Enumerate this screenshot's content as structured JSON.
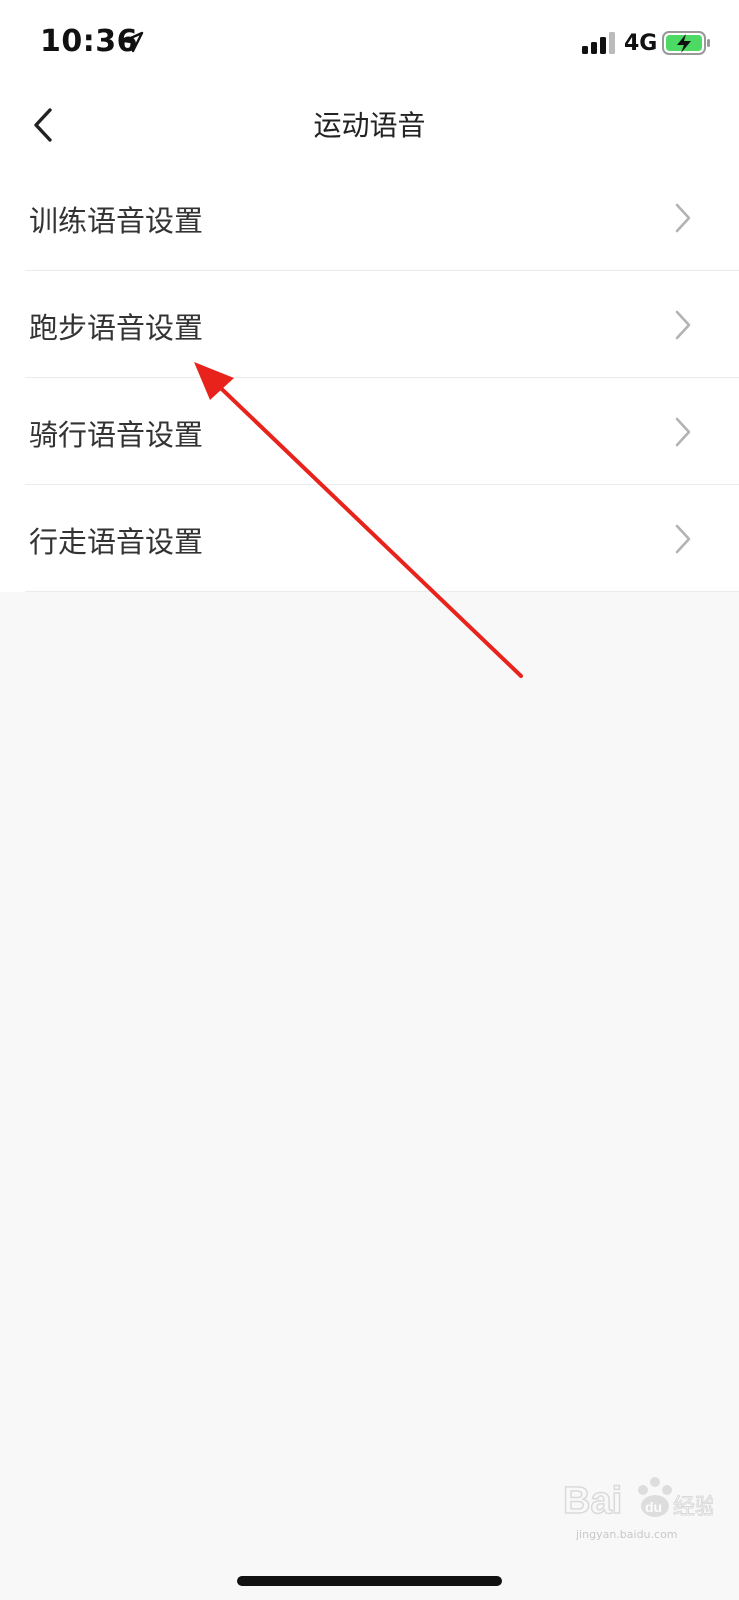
{
  "status_bar": {
    "time": "10:36",
    "network": "4G",
    "icons": [
      "location-arrow-icon",
      "signal-icon",
      "battery-charging-icon"
    ]
  },
  "nav": {
    "title": "运动语音",
    "back_icon": "chevron-left-icon"
  },
  "menu": {
    "items": [
      {
        "label": "训练语音设置"
      },
      {
        "label": "跑步语音设置"
      },
      {
        "label": "骑行语音设置"
      },
      {
        "label": "行走语音设置"
      }
    ]
  },
  "annotation": {
    "color": "#e8231b",
    "icon": "red-arrow"
  },
  "watermark": {
    "text": "Bai du 经验",
    "sub": "jingyan.baidu.com"
  },
  "colors": {
    "background": "#f8f8f8",
    "list_background": "#ffffff",
    "battery_green": "#4cd964"
  }
}
